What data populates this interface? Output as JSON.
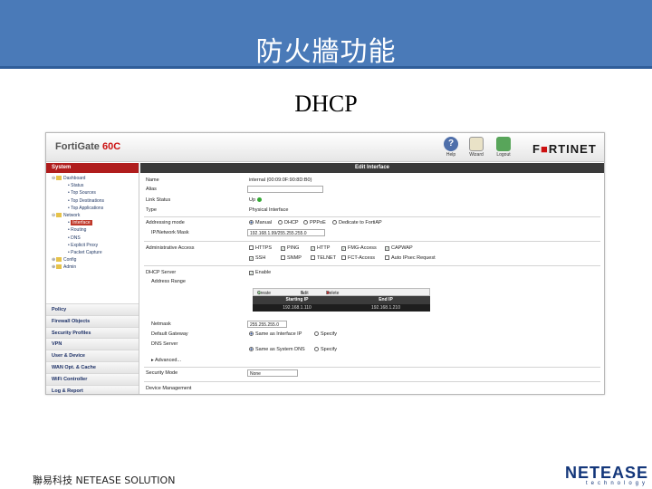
{
  "slide": {
    "title": "防火牆功能",
    "subtitle": "DHCP",
    "footer_text": "聯易科技 NETEASE SOLUTION",
    "logo_main": "NETEASE",
    "logo_sub": "technology"
  },
  "app": {
    "product": "FortiGate",
    "model": "60C",
    "brand_prefix": "F",
    "brand_mark": "■",
    "brand_rest": "RTINET",
    "toolbar": {
      "help_label": "Help",
      "wizard_label": "Wizard",
      "logout_label": "Logout"
    }
  },
  "sidebar": {
    "system_label": "System",
    "tree": [
      {
        "label": "Dashboard",
        "level": 0,
        "exp": "⊖"
      },
      {
        "label": "Status",
        "level": 1
      },
      {
        "label": "Top Sources",
        "level": 1
      },
      {
        "label": "Top Destinations",
        "level": 1
      },
      {
        "label": "Top Applications",
        "level": 1
      },
      {
        "label": "Network",
        "level": 0,
        "exp": "⊖"
      },
      {
        "label": "Interface",
        "level": 1,
        "selected": true
      },
      {
        "label": "Routing",
        "level": 1
      },
      {
        "label": "DNS",
        "level": 1
      },
      {
        "label": "Explicit Proxy",
        "level": 1
      },
      {
        "label": "Packet Capture",
        "level": 1
      },
      {
        "label": "Config",
        "level": 0,
        "exp": "⊕"
      },
      {
        "label": "Admin",
        "level": 0,
        "exp": "⊕"
      }
    ],
    "sections": [
      "Policy",
      "Firewall Objects",
      "Security Profiles",
      "VPN",
      "User & Device",
      "WAN Opt. & Cache",
      "WiFi Controller",
      "Log & Report"
    ]
  },
  "panel": {
    "title": "Edit Interface",
    "name_label": "Name",
    "name_value": "internal (00:09:0F:90:8D:B0)",
    "alias_label": "Alias",
    "alias_value": "",
    "link_status_label": "Link Status",
    "link_status_value": "Up",
    "type_label": "Type",
    "type_value": "Physical Interface",
    "addressing_label": "Addressing mode",
    "addressing_options": [
      "Manual",
      "DHCP",
      "PPPoE",
      "Dedicate to FortiAP"
    ],
    "ip_mask_label": "IP/Network Mask",
    "ip_mask_value": "192.168.1.99/255.255.255.0",
    "admin_access_label": "Administrative Access",
    "admin_access_row1": [
      "HTTPS",
      "PING",
      "HTTP",
      "FMG-Access",
      "CAPWAP"
    ],
    "admin_access_row2": [
      "SSH",
      "SNMP",
      "TELNET",
      "FCT-Access",
      "Auto IPsec Request"
    ],
    "dhcp_label": "DHCP Server",
    "dhcp_enable": "Enable",
    "address_range_label": "Address Range",
    "range_create": "Create New",
    "range_edit": "Edit",
    "range_delete": "Delete",
    "range_headers": [
      "Starting IP",
      "End IP"
    ],
    "range_rows": [
      [
        "192.168.1.110",
        "192.168.1.210"
      ]
    ],
    "netmask_label": "Netmask",
    "netmask_value": "255.255.255.0",
    "gateway_label": "Default Gateway",
    "gateway_options": [
      "Same as Interface IP",
      "Specify"
    ],
    "dns_label": "DNS Server",
    "dns_options": [
      "Same as System DNS",
      "Specify"
    ],
    "advanced_label": "Advanced...",
    "security_mode_label": "Security Mode",
    "security_mode_value": "None",
    "device_mgmt_label": "Device Management"
  }
}
